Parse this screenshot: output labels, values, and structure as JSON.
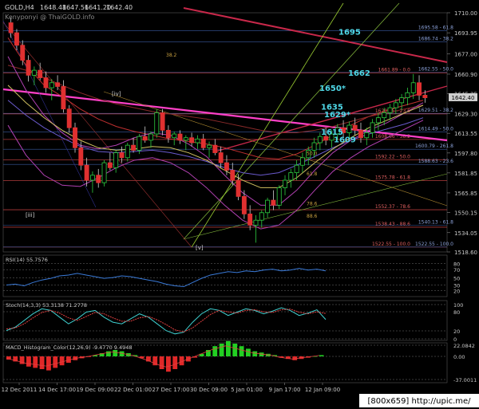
{
  "chart_data": [
    {
      "type": "line",
      "title": "GOLD,H4",
      "ohlc": {
        "open": "1648.48",
        "high": "1647.56",
        "low": "1641.20",
        "close": "1642.40"
      },
      "watermark": "Kenyponyi @ ThaiGOLD.info",
      "ylim": [
        1518.6,
        1710.0
      ],
      "y_ticks": [
        "1710.00",
        "1693.95",
        "1677.00",
        "1660.90",
        "1645.25",
        "1629.30",
        "1613.55",
        "1597.80",
        "1581.85",
        "1565.85",
        "1550.15",
        "1534.05",
        "1518.60"
      ],
      "current_price_tag": "1642.40",
      "x_ticks": [
        "12 Dec 2011",
        "14 Dec 17:00",
        "19 Dec 09:00",
        "22 Dec 01:00",
        "27 Dec 17:00",
        "30 Dec 09:00",
        "5 Jan 01:00",
        "9 Jan 17:00",
        "12 Jan 09:00"
      ],
      "wave_labels": [
        "[iv]",
        "[iii]",
        "[v]"
      ],
      "fib_retracement": [
        {
          "label": "1661.89 - 0.0",
          "y": 1661.89
        },
        {
          "label": "1629.05 - 23.6",
          "y": 1629.05
        },
        {
          "label": "1608.66 - 38.2",
          "y": 1608.66
        },
        {
          "label": "1592.22 - 50.0",
          "y": 1592.22
        },
        {
          "label": "1575.78 - 61.8",
          "y": 1575.78
        },
        {
          "label": "1552.37 - 78.6",
          "y": 1552.37
        },
        {
          "label": "1538.43 - 88.6",
          "y": 1538.43
        },
        {
          "label": "1522.55 - 100.0",
          "y": 1522.55
        }
      ],
      "fib_projection": [
        {
          "label": "1695.58 - 61.8",
          "y": 1695.58
        },
        {
          "label": "1686.74 - 38.2",
          "y": 1686.74
        },
        {
          "label": "1662.55 - 50.0",
          "y": 1662.55
        },
        {
          "label": "1629.51 - 38.2",
          "y": 1629.51
        },
        {
          "label": "1614.49 - 50.0",
          "y": 1614.49
        },
        {
          "label": "1600.79 - 261.8",
          "y": 1600.79
        },
        {
          "label": "1588.63 - 23.6",
          "y": 1588.63
        },
        {
          "label": "1540.13 - 61.8",
          "y": 1540.13
        },
        {
          "label": "1522.55 - 100.0",
          "y": 1522.55
        }
      ],
      "level_tags": [
        {
          "label": "1695",
          "y": 1695
        },
        {
          "label": "1662",
          "y": 1662
        },
        {
          "label": "1650*",
          "y": 1650
        },
        {
          "label": "1635",
          "y": 1635
        },
        {
          "label": "1629*",
          "y": 1629
        },
        {
          "label": "1615",
          "y": 1615
        },
        {
          "label": "1609",
          "y": 1609
        }
      ],
      "fan_labels": [
        {
          "label": "38.2",
          "y": 1675
        },
        {
          "label": "50.0",
          "y": 1596
        },
        {
          "label": "61.8",
          "y": 1580
        },
        {
          "label": "78.6",
          "y": 1556
        },
        {
          "label": "88.6",
          "y": 1546
        }
      ],
      "candles": [
        [
          1702,
          1706,
          1690,
          1694
        ],
        [
          1694,
          1697,
          1680,
          1684
        ],
        [
          1684,
          1688,
          1668,
          1672
        ],
        [
          1672,
          1676,
          1655,
          1660
        ],
        [
          1660,
          1667,
          1652,
          1664
        ],
        [
          1664,
          1670,
          1656,
          1658
        ],
        [
          1658,
          1663,
          1646,
          1650
        ],
        [
          1650,
          1657,
          1640,
          1654
        ],
        [
          1654,
          1660,
          1648,
          1651
        ],
        [
          1651,
          1656,
          1630,
          1633
        ],
        [
          1633,
          1636,
          1614,
          1618
        ],
        [
          1618,
          1622,
          1598,
          1602
        ],
        [
          1602,
          1607,
          1584,
          1588
        ],
        [
          1588,
          1594,
          1571,
          1576
        ],
        [
          1576,
          1583,
          1566,
          1580
        ],
        [
          1580,
          1585,
          1570,
          1574
        ],
        [
          1574,
          1592,
          1571,
          1590
        ],
        [
          1590,
          1598,
          1584,
          1586
        ],
        [
          1586,
          1600,
          1582,
          1598
        ],
        [
          1598,
          1603,
          1590,
          1594
        ],
        [
          1594,
          1606,
          1591,
          1604
        ],
        [
          1604,
          1610,
          1598,
          1600
        ],
        [
          1600,
          1613,
          1597,
          1611
        ],
        [
          1611,
          1619,
          1606,
          1608
        ],
        [
          1608,
          1615,
          1602,
          1613
        ],
        [
          1613,
          1633,
          1610,
          1630
        ],
        [
          1630,
          1633,
          1612,
          1616
        ],
        [
          1616,
          1620,
          1606,
          1610
        ],
        [
          1610,
          1615,
          1604,
          1613
        ],
        [
          1613,
          1616,
          1605,
          1608
        ],
        [
          1608,
          1612,
          1600,
          1610
        ],
        [
          1610,
          1614,
          1603,
          1606
        ],
        [
          1606,
          1612,
          1601,
          1609
        ],
        [
          1609,
          1613,
          1600,
          1602
        ],
        [
          1602,
          1607,
          1594,
          1604
        ],
        [
          1604,
          1609,
          1596,
          1598
        ],
        [
          1598,
          1603,
          1586,
          1590
        ],
        [
          1590,
          1596,
          1580,
          1584
        ],
        [
          1584,
          1590,
          1572,
          1576
        ],
        [
          1576,
          1581,
          1560,
          1563
        ],
        [
          1563,
          1568,
          1545,
          1549
        ],
        [
          1549,
          1556,
          1536,
          1540
        ],
        [
          1540,
          1548,
          1526,
          1544
        ],
        [
          1544,
          1552,
          1538,
          1550
        ],
        [
          1550,
          1562,
          1546,
          1560
        ],
        [
          1560,
          1568,
          1552,
          1556
        ],
        [
          1556,
          1572,
          1553,
          1570
        ],
        [
          1570,
          1580,
          1564,
          1576
        ],
        [
          1576,
          1585,
          1570,
          1582
        ],
        [
          1582,
          1592,
          1576,
          1588
        ],
        [
          1588,
          1598,
          1582,
          1594
        ],
        [
          1594,
          1603,
          1588,
          1600
        ],
        [
          1600,
          1610,
          1594,
          1606
        ],
        [
          1606,
          1614,
          1600,
          1611
        ],
        [
          1611,
          1618,
          1604,
          1608
        ],
        [
          1608,
          1616,
          1602,
          1613
        ],
        [
          1613,
          1621,
          1608,
          1618
        ],
        [
          1618,
          1624,
          1610,
          1614
        ],
        [
          1614,
          1623,
          1609,
          1620
        ],
        [
          1620,
          1626,
          1612,
          1616
        ],
        [
          1616,
          1622,
          1606,
          1610
        ],
        [
          1610,
          1618,
          1604,
          1614
        ],
        [
          1614,
          1625,
          1610,
          1622
        ],
        [
          1622,
          1630,
          1616,
          1626
        ],
        [
          1626,
          1634,
          1620,
          1630
        ],
        [
          1630,
          1637,
          1624,
          1634
        ],
        [
          1634,
          1641,
          1629,
          1638
        ],
        [
          1638,
          1645,
          1632,
          1642
        ],
        [
          1642,
          1650,
          1636,
          1646
        ],
        [
          1646,
          1661,
          1641,
          1654
        ],
        [
          1654,
          1660,
          1640,
          1644
        ],
        [
          1644,
          1648,
          1638,
          1642
        ]
      ],
      "ma_series": [
        {
          "color": "#c03030",
          "values": [
            1690,
            1668,
            1652,
            1643,
            1633,
            1625,
            1619,
            1615,
            1612,
            1609,
            1607,
            1605,
            1602,
            1598,
            1594,
            1593,
            1597,
            1604,
            1612,
            1620,
            1627,
            1632,
            1636,
            1640
          ]
        },
        {
          "color": "#8a2a2a",
          "values": [
            1668,
            1664,
            1658,
            1652,
            1646,
            1641,
            1637,
            1634,
            1631,
            1629,
            1627,
            1625,
            1622,
            1619,
            1616,
            1614,
            1614,
            1616,
            1619,
            1623,
            1627,
            1630,
            1633,
            1636
          ]
        },
        {
          "color": "#6a5acd",
          "values": [
            1640,
            1628,
            1618,
            1610,
            1603,
            1599,
            1598,
            1599,
            1600,
            1598,
            1595,
            1591,
            1586,
            1582,
            1580,
            1582,
            1588,
            1595,
            1602,
            1608,
            1613,
            1617,
            1621,
            1626
          ]
        },
        {
          "color": "#b040b0",
          "values": [
            1675,
            1648,
            1628,
            1614,
            1604,
            1601,
            1604,
            1610,
            1614,
            1612,
            1605,
            1595,
            1580,
            1566,
            1556,
            1556,
            1568,
            1584,
            1598,
            1608,
            1616,
            1622,
            1630,
            1638
          ]
        },
        {
          "color": "#b040b0",
          "values": [
            1620,
            1596,
            1580,
            1572,
            1571,
            1578,
            1586,
            1592,
            1594,
            1590,
            1582,
            1570,
            1556,
            1544,
            1537,
            1540,
            1552,
            1568,
            1583,
            1594,
            1603,
            1610,
            1617,
            1624
          ]
        },
        {
          "color": "#d0c060",
          "values": [
            1652,
            1638,
            1626,
            1616,
            1608,
            1602,
            1600,
            1601,
            1603,
            1602,
            1598,
            1592,
            1584,
            1576,
            1570,
            1570,
            1578,
            1590,
            1601,
            1610,
            1618,
            1624,
            1630,
            1636
          ]
        }
      ],
      "rsi": {
        "label": "RSI(14) 55.7576",
        "levels": [
          "80",
          "70",
          "50",
          "30",
          "20"
        ],
        "values": [
          28,
          30,
          26,
          34,
          40,
          44,
          50,
          52,
          56,
          52,
          48,
          44,
          46,
          50,
          48,
          44,
          40,
          36,
          30,
          26,
          24,
          34,
          44,
          52,
          56,
          60,
          58,
          62,
          60,
          64,
          66,
          62,
          64,
          68,
          64,
          66,
          62
        ]
      },
      "stoch": {
        "label": "Stoch(14,3,3) 53.3138 71.2778",
        "levels": [
          "100",
          "80",
          "20",
          "0"
        ],
        "k": [
          20,
          30,
          50,
          70,
          85,
          80,
          60,
          40,
          55,
          75,
          80,
          60,
          45,
          40,
          55,
          70,
          60,
          40,
          20,
          10,
          15,
          45,
          70,
          85,
          80,
          65,
          75,
          85,
          80,
          70,
          78,
          88,
          80,
          65,
          72,
          82,
          53
        ],
        "d": [
          25,
          28,
          40,
          58,
          74,
          80,
          72,
          58,
          50,
          62,
          74,
          70,
          58,
          48,
          48,
          58,
          62,
          52,
          38,
          22,
          16,
          28,
          48,
          68,
          80,
          76,
          72,
          80,
          82,
          76,
          74,
          82,
          84,
          75,
          70,
          76,
          71
        ]
      },
      "macd": {
        "label": "MACD_Histogram_Color(12,26,9) -9.4770 9.4948",
        "levels": [
          "22.0842",
          "0.00",
          "-37.0011"
        ],
        "hist": [
          -5,
          -8,
          -12,
          -16,
          -18,
          -20,
          -22,
          -18,
          -14,
          -10,
          -6,
          -3,
          -1,
          2,
          5,
          8,
          10,
          8,
          5,
          2,
          -3,
          -8,
          -14,
          -20,
          -24,
          -20,
          -14,
          -8,
          -2,
          4,
          10,
          16,
          20,
          24,
          20,
          16,
          12,
          8,
          6,
          4,
          2,
          -2,
          -4,
          -6,
          -4,
          -2,
          0,
          2
        ]
      }
    }
  ],
  "footer": {
    "caption": "[800x659] http://upic.me/"
  }
}
